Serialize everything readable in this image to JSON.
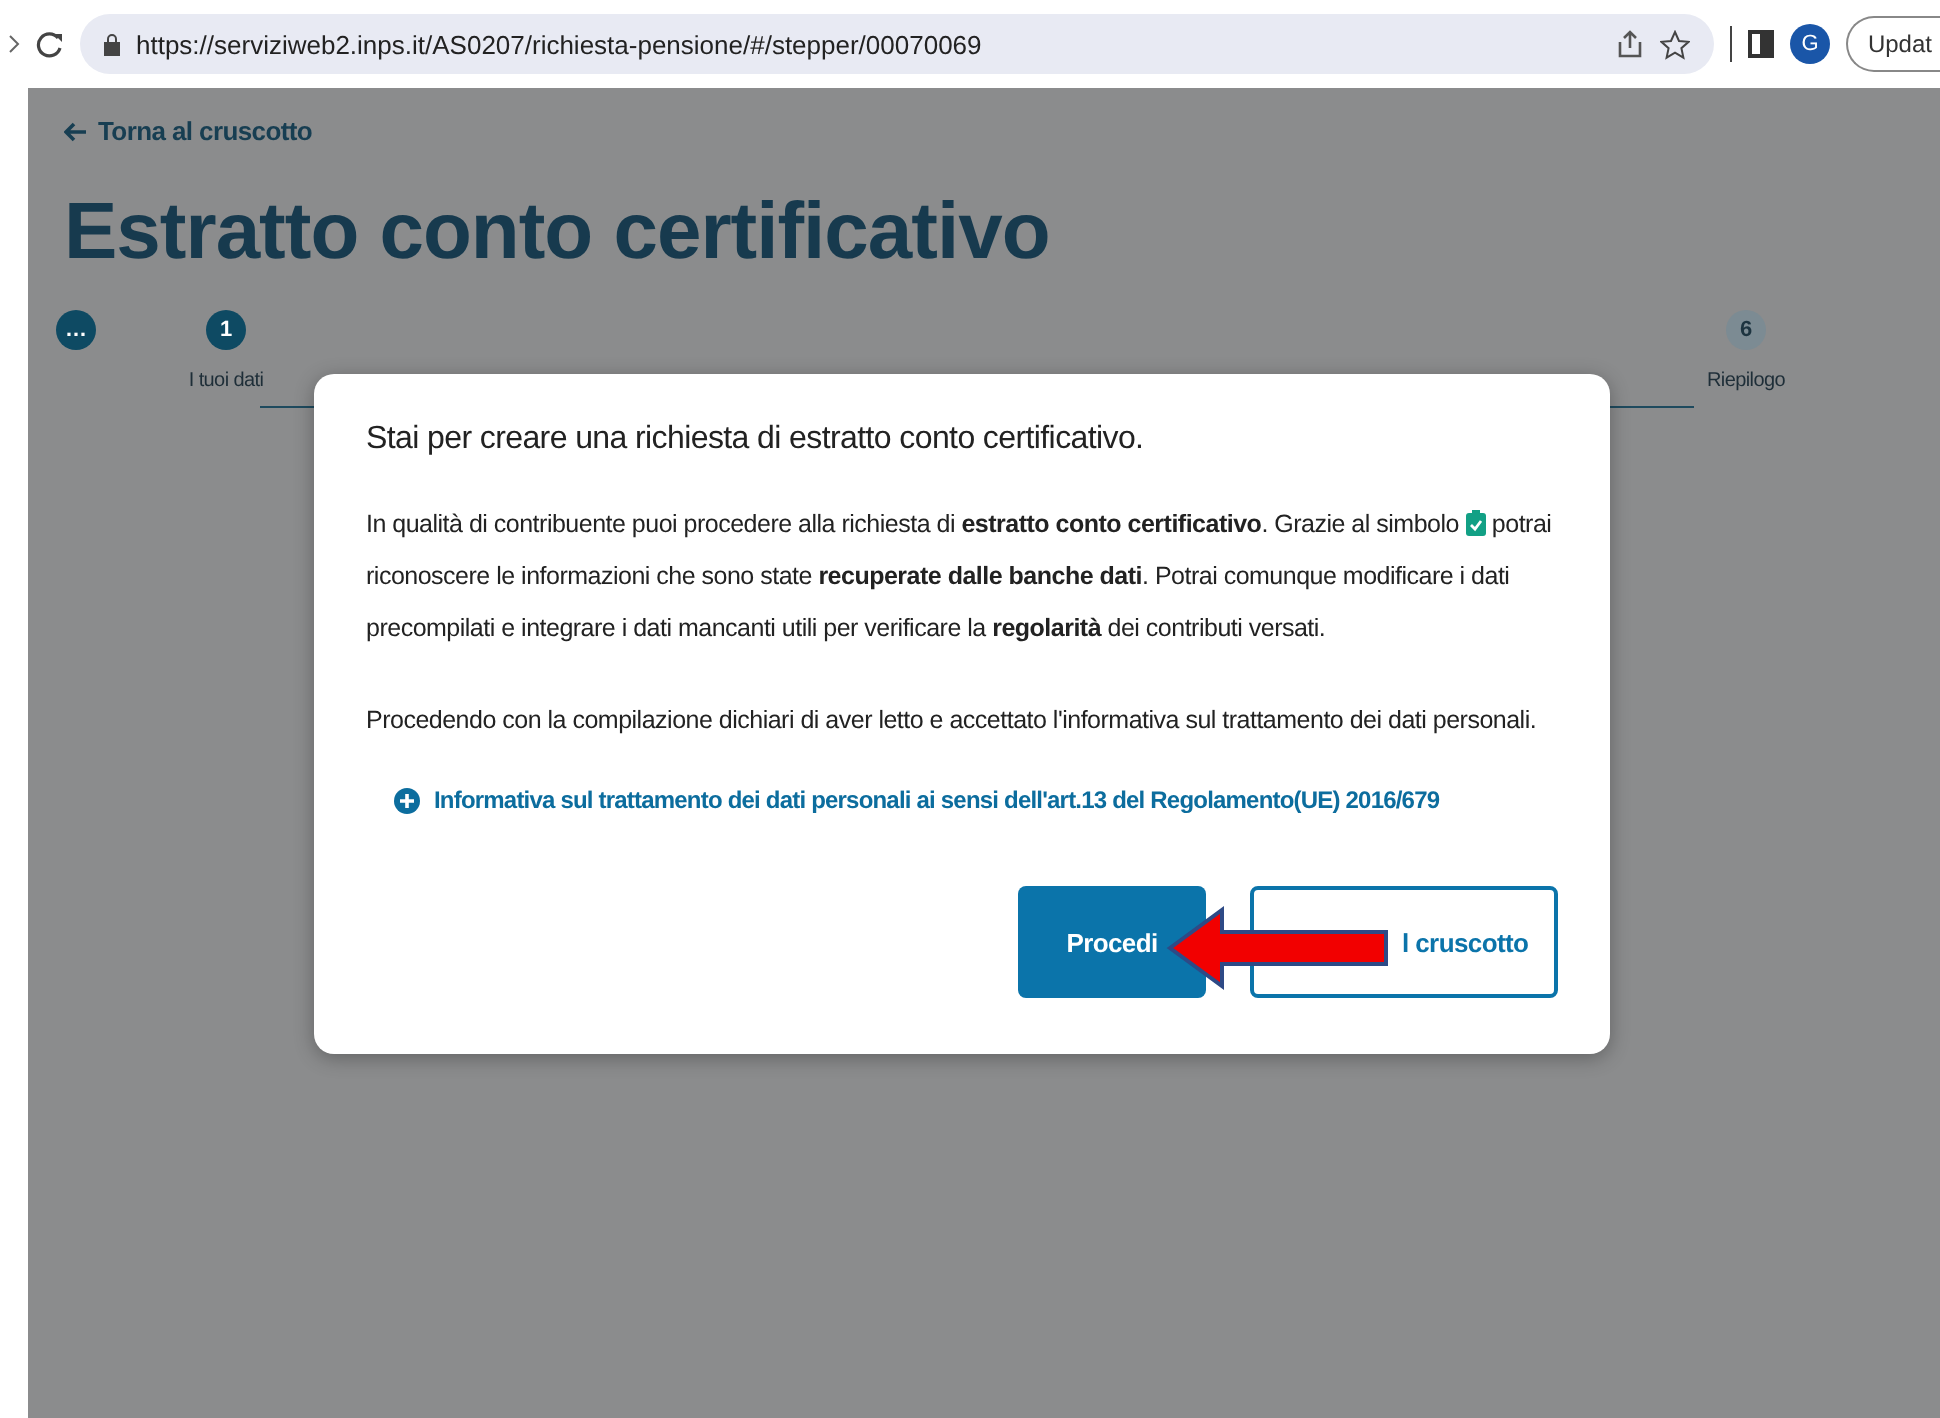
{
  "browser": {
    "url": "https://serviziweb2.inps.it/AS0207/richiesta-pensione/#/stepper/00070069",
    "avatar": "G",
    "update_button": "Updat"
  },
  "back_link": "Torna al cruscotto",
  "title": "Estratto conto certificativo",
  "stepper": [
    {
      "label": "…",
      "current": true
    },
    {
      "label": "1",
      "caption": "I tuoi dati",
      "current": true
    },
    {
      "label": "6",
      "caption": "Riepilogo",
      "current": false
    }
  ],
  "dialog": {
    "heading": "Stai per creare una richiesta di estratto conto certificativo.",
    "paragraph_1": "In qualità di contribuente puoi procedere alla richiesta di **estratto conto certificativo**. Grazie al simbolo",
    "paragraph_1_cont": "potrai riconoscere le informazioni che sono state **recuperate dalle banche dati**. Potrai comunque modificare i dati precompilati e integrare i dati mancanti utili per verificare la **regolarità** dei contributi versati.",
    "paragraph_2": "Procedendo con la compilazione dichiari di aver letto e accettato l'informativa sul trattamento dei dati personali.",
    "info_link": "Informativa sul trattamento dei dati personali ai sensi dell'art.13 del Regolamento(UE) 2016/679",
    "buttons": [
      {
        "label": "Procedi",
        "kind": "primary"
      },
      {
        "label": "l cruscotto",
        "kind": "secondary"
      }
    ]
  }
}
